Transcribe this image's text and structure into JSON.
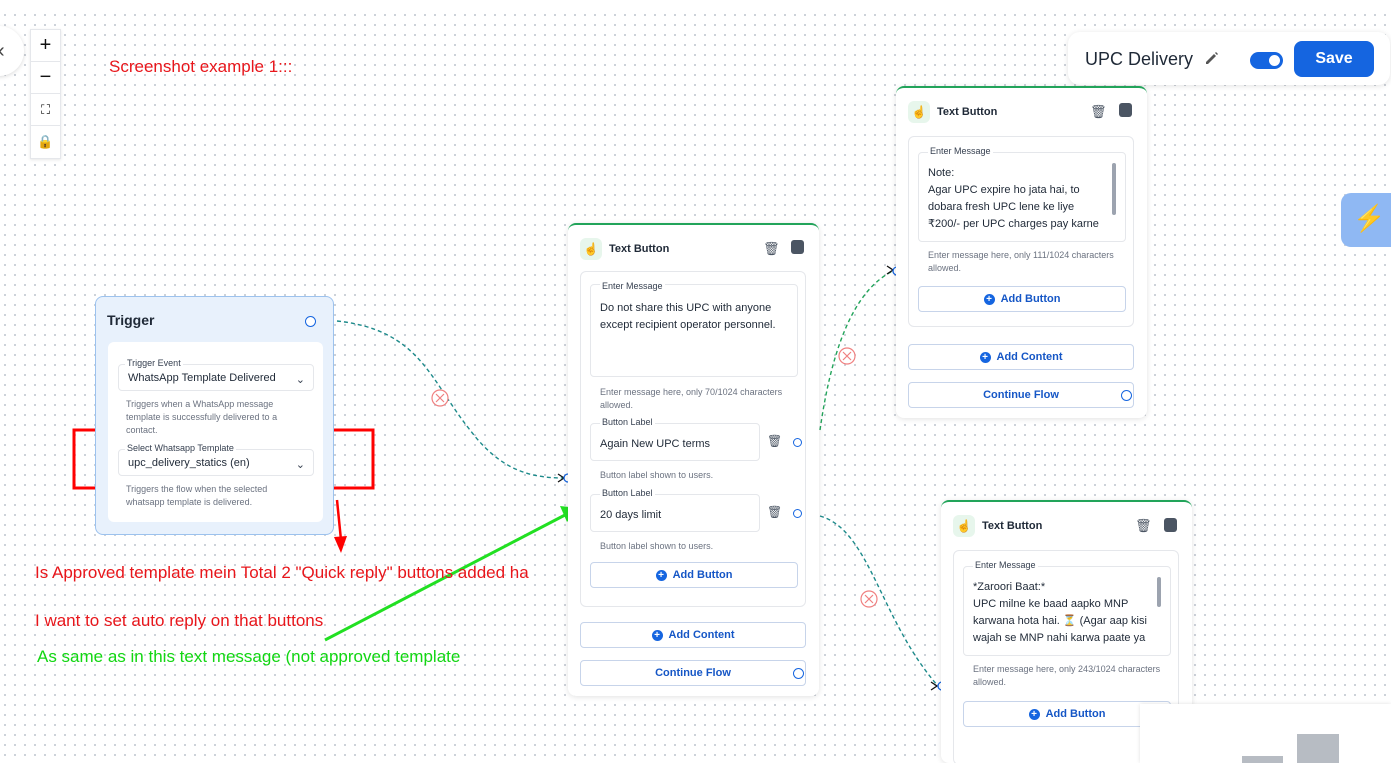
{
  "controls": {
    "zoom_in": "+",
    "zoom_out": "−",
    "fit": "⛶",
    "lock": "🔒"
  },
  "annotations": {
    "title": "Screenshot example 1:::",
    "line1": "Is Approved template mein Total 2 \"Quick reply\" buttons added ha",
    "line2": "I want to set auto reply on that buttons",
    "line3": "As same as in this text message (not approved template"
  },
  "header": {
    "flow_name": "UPC Delivery",
    "save_label": "Save",
    "active": true
  },
  "trigger": {
    "title": "Trigger",
    "event_label": "Trigger Event",
    "event_value": "WhatsApp Template Delivered",
    "event_hint": "Triggers when a WhatsApp message template is successfully delivered to a contact.",
    "template_label": "Select Whatsapp Template",
    "template_value": "upc_delivery_statics (en)",
    "template_hint": "Triggers the flow when the selected whatsapp template is delivered."
  },
  "node_main": {
    "title": "Text Button",
    "message_label": "Enter Message",
    "message": "Do not share this UPC with anyone except recipient operator personnel.",
    "message_hint": "Enter message here, only 70/1024 characters allowed.",
    "buttons": [
      {
        "label_caption": "Button Label",
        "value": "Again New UPC terms",
        "hint": "Button label shown to users."
      },
      {
        "label_caption": "Button Label",
        "value": "20 days limit",
        "hint": "Button label shown to users."
      }
    ],
    "add_button": "Add Button",
    "add_content": "Add Content",
    "continue_flow": "Continue Flow"
  },
  "node_top": {
    "title": "Text Button",
    "message_label": "Enter Message",
    "message": "Note:\nAgar UPC expire ho jata hai, to dobara fresh UPC lene ke liye ₹200/- per UPC charges pay karne",
    "message_hint": "Enter message here, only 111/1024 characters allowed.",
    "add_button": "Add Button",
    "add_content": "Add Content",
    "continue_flow": "Continue Flow"
  },
  "node_bottom": {
    "title": "Text Button",
    "message_label": "Enter Message",
    "message": "*Zaroori Baat:*\nUPC milne ke baad aapko MNP karwana hota hai. ⏳ (Agar aap kisi wajah se MNP nahi karwa paate ya",
    "message_hint": "Enter message here, only 243/1024 characters allowed.",
    "add_button": "Add Button"
  },
  "colors": {
    "accent": "#1565e0",
    "node_border": "#22a45a",
    "annotation_red": "#e8161b",
    "annotation_green": "#12d712"
  }
}
